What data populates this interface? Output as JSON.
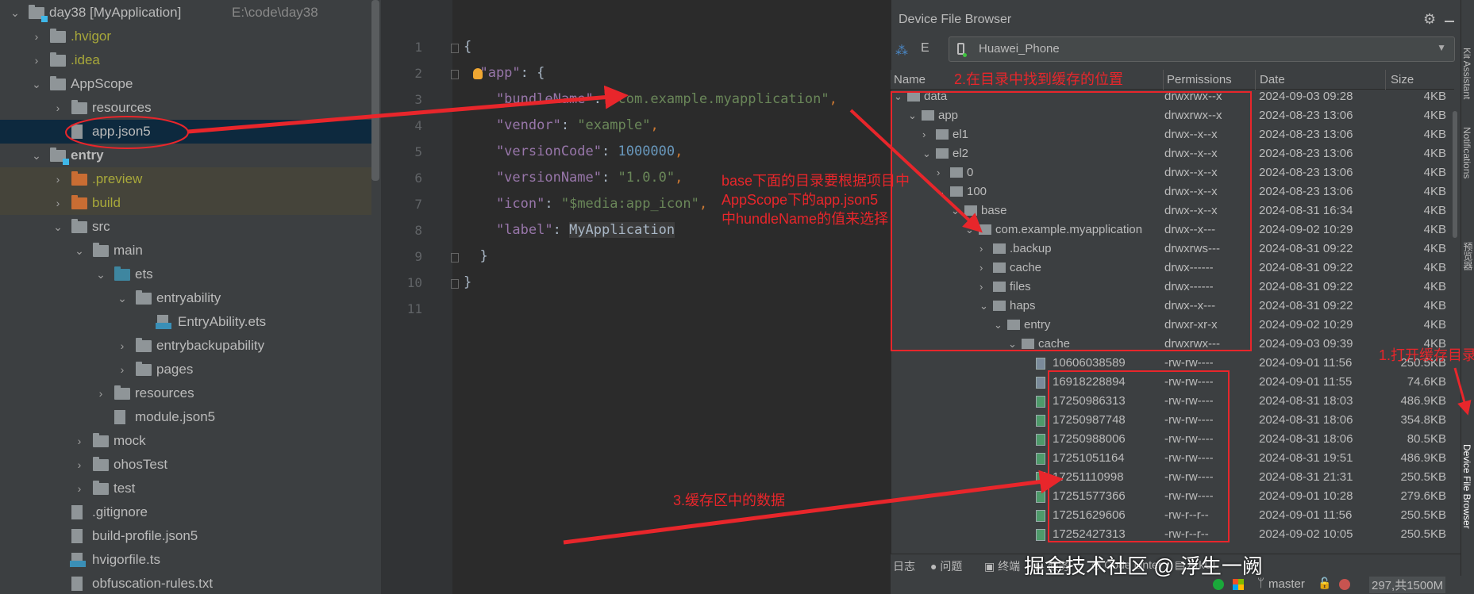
{
  "project_tree": [
    {
      "level": 0,
      "chev": "v",
      "icon": "project",
      "label": "day38 [MyApplication]",
      "path": "E:\\code\\day38"
    },
    {
      "level": 1,
      "chev": ">",
      "icon": "folder",
      "label": ".hvigor",
      "color": "#a8a83a"
    },
    {
      "level": 1,
      "chev": ">",
      "icon": "folder",
      "label": ".idea",
      "color": "#a8a83a"
    },
    {
      "level": 1,
      "chev": "v",
      "icon": "folder",
      "label": "AppScope"
    },
    {
      "level": 2,
      "chev": ">",
      "icon": "folder",
      "label": "resources"
    },
    {
      "level": 2,
      "chev": "",
      "icon": "json",
      "label": "app.json5",
      "selected": true
    },
    {
      "level": 1,
      "chev": "v",
      "icon": "module",
      "label": "entry",
      "bold": true
    },
    {
      "level": 2,
      "chev": ">",
      "icon": "folder-orange",
      "label": ".preview",
      "color": "#a8a83a",
      "excluded": true
    },
    {
      "level": 2,
      "chev": ">",
      "icon": "folder-orange",
      "label": "build",
      "color": "#a8a83a",
      "excluded": true
    },
    {
      "level": 2,
      "chev": "v",
      "icon": "folder",
      "label": "src"
    },
    {
      "level": 3,
      "chev": "v",
      "icon": "folder",
      "label": "main"
    },
    {
      "level": 4,
      "chev": "v",
      "icon": "folder-blue",
      "label": "ets"
    },
    {
      "level": 5,
      "chev": "v",
      "icon": "folder",
      "label": "entryability"
    },
    {
      "level": 6,
      "chev": "",
      "icon": "ets",
      "label": "EntryAbility.ets"
    },
    {
      "level": 5,
      "chev": ">",
      "icon": "folder",
      "label": "entrybackupability"
    },
    {
      "level": 5,
      "chev": ">",
      "icon": "folder",
      "label": "pages"
    },
    {
      "level": 4,
      "chev": ">",
      "icon": "folder",
      "label": "resources"
    },
    {
      "level": 4,
      "chev": "",
      "icon": "json",
      "label": "module.json5"
    },
    {
      "level": 3,
      "chev": ">",
      "icon": "folder",
      "label": "mock"
    },
    {
      "level": 3,
      "chev": ">",
      "icon": "folder",
      "label": "ohosTest"
    },
    {
      "level": 3,
      "chev": ">",
      "icon": "folder",
      "label": "test"
    },
    {
      "level": 2,
      "chev": "",
      "icon": "ignore",
      "label": ".gitignore"
    },
    {
      "level": 2,
      "chev": "",
      "icon": "json",
      "label": "build-profile.json5"
    },
    {
      "level": 2,
      "chev": "",
      "icon": "ts",
      "label": "hvigorfile.ts"
    },
    {
      "level": 2,
      "chev": "",
      "icon": "text",
      "label": "obfuscation-rules.txt"
    }
  ],
  "editor": {
    "line_numbers": [
      "1",
      "2",
      "3",
      "4",
      "5",
      "6",
      "7",
      "8",
      "9",
      "10",
      "11"
    ],
    "lines": [
      [
        {
          "t": "{",
          "c": "b"
        }
      ],
      [
        {
          "t": "  \"app\"",
          "c": "k"
        },
        {
          "t": ": {",
          "c": "b"
        }
      ],
      [
        {
          "t": "    \"bundleName\"",
          "c": "k"
        },
        {
          "t": ": ",
          "c": "b"
        },
        {
          "t": "\"com.example.myapplication\"",
          "c": "s"
        },
        {
          "t": ",",
          "c": "p"
        }
      ],
      [
        {
          "t": "    \"vendor\"",
          "c": "k"
        },
        {
          "t": ": ",
          "c": "b"
        },
        {
          "t": "\"example\"",
          "c": "s"
        },
        {
          "t": ",",
          "c": "p"
        }
      ],
      [
        {
          "t": "    \"versionCode\"",
          "c": "k"
        },
        {
          "t": ": ",
          "c": "b"
        },
        {
          "t": "1000000",
          "c": "n"
        },
        {
          "t": ",",
          "c": "p"
        }
      ],
      [
        {
          "t": "    \"versionName\"",
          "c": "k"
        },
        {
          "t": ": ",
          "c": "b"
        },
        {
          "t": "\"1.0.0\"",
          "c": "s"
        },
        {
          "t": ",",
          "c": "p"
        }
      ],
      [
        {
          "t": "    \"icon\"",
          "c": "k"
        },
        {
          "t": ": ",
          "c": "b"
        },
        {
          "t": "\"$media:app_icon\"",
          "c": "s"
        },
        {
          "t": ",",
          "c": "p"
        }
      ],
      [
        {
          "t": "    \"label\"",
          "c": "k"
        },
        {
          "t": ": ",
          "c": "b"
        },
        {
          "t": "MyApplication",
          "c": "b"
        }
      ],
      [
        {
          "t": "  }",
          "c": "b"
        }
      ],
      [
        {
          "t": "}",
          "c": "b"
        }
      ],
      []
    ]
  },
  "device_file_browser": {
    "title": "Device File Browser",
    "device": "Huawei_Phone",
    "columns": {
      "name": "Name",
      "permissions": "Permissions",
      "date": "Date",
      "size": "Size"
    },
    "rows": [
      {
        "level": 0,
        "chev": "v",
        "type": "dir",
        "name": "data",
        "perm": "drwxrwx--x",
        "date": "2024-09-03 09:28",
        "size": "4KB"
      },
      {
        "level": 1,
        "chev": "v",
        "type": "dir",
        "name": "app",
        "perm": "drwxrwx--x",
        "date": "2024-08-23 13:06",
        "size": "4KB"
      },
      {
        "level": 2,
        "chev": ">",
        "type": "dir",
        "name": "el1",
        "perm": "drwx--x--x",
        "date": "2024-08-23 13:06",
        "size": "4KB"
      },
      {
        "level": 2,
        "chev": "v",
        "type": "dir",
        "name": "el2",
        "perm": "drwx--x--x",
        "date": "2024-08-23 13:06",
        "size": "4KB"
      },
      {
        "level": 3,
        "chev": ">",
        "type": "dir",
        "name": "0",
        "perm": "drwx--x--x",
        "date": "2024-08-23 13:06",
        "size": "4KB"
      },
      {
        "level": 3,
        "chev": "v",
        "type": "dir",
        "name": "100",
        "perm": "drwx--x--x",
        "date": "2024-08-23 13:06",
        "size": "4KB"
      },
      {
        "level": 4,
        "chev": "v",
        "type": "dir",
        "name": "base",
        "perm": "drwx--x--x",
        "date": "2024-08-31 16:34",
        "size": "4KB"
      },
      {
        "level": 5,
        "chev": "v",
        "type": "dir",
        "name": "com.example.myapplication",
        "perm": "drwx--x---",
        "date": "2024-09-02 10:29",
        "size": "4KB"
      },
      {
        "level": 6,
        "chev": ">",
        "type": "dir",
        "name": ".backup",
        "perm": "drwxrws---",
        "date": "2024-08-31 09:22",
        "size": "4KB"
      },
      {
        "level": 6,
        "chev": ">",
        "type": "dir",
        "name": "cache",
        "perm": "drwx------",
        "date": "2024-08-31 09:22",
        "size": "4KB"
      },
      {
        "level": 6,
        "chev": ">",
        "type": "dir",
        "name": "files",
        "perm": "drwx------",
        "date": "2024-08-31 09:22",
        "size": "4KB"
      },
      {
        "level": 6,
        "chev": "v",
        "type": "dir",
        "name": "haps",
        "perm": "drwx--x---",
        "date": "2024-08-31 09:22",
        "size": "4KB"
      },
      {
        "level": 7,
        "chev": "v",
        "type": "dir",
        "name": "entry",
        "perm": "drwxr-xr-x",
        "date": "2024-09-02 10:29",
        "size": "4KB"
      },
      {
        "level": 8,
        "chev": "v",
        "type": "dir",
        "name": "cache",
        "perm": "drwxrwx---",
        "date": "2024-09-03 09:39",
        "size": "4KB"
      },
      {
        "level": 9,
        "chev": "",
        "type": "unknown",
        "name": "10606038589",
        "perm": "-rw-rw----",
        "date": "2024-09-01 11:56",
        "size": "250.5KB"
      },
      {
        "level": 9,
        "chev": "",
        "type": "unknown",
        "name": "16918228894",
        "perm": "-rw-rw----",
        "date": "2024-09-01 11:55",
        "size": "74.6KB"
      },
      {
        "level": 9,
        "chev": "",
        "type": "image",
        "name": "17250986313",
        "perm": "-rw-rw----",
        "date": "2024-08-31 18:03",
        "size": "486.9KB"
      },
      {
        "level": 9,
        "chev": "",
        "type": "image",
        "name": "17250987748",
        "perm": "-rw-rw----",
        "date": "2024-08-31 18:06",
        "size": "354.8KB"
      },
      {
        "level": 9,
        "chev": "",
        "type": "image",
        "name": "17250988006",
        "perm": "-rw-rw----",
        "date": "2024-08-31 18:06",
        "size": "80.5KB"
      },
      {
        "level": 9,
        "chev": "",
        "type": "image",
        "name": "17251051164",
        "perm": "-rw-rw----",
        "date": "2024-08-31 19:51",
        "size": "486.9KB"
      },
      {
        "level": 9,
        "chev": "",
        "type": "image",
        "name": "17251110998",
        "perm": "-rw-rw----",
        "date": "2024-08-31 21:31",
        "size": "250.5KB"
      },
      {
        "level": 9,
        "chev": "",
        "type": "image",
        "name": "17251577366",
        "perm": "-rw-rw----",
        "date": "2024-09-01 10:28",
        "size": "279.6KB"
      },
      {
        "level": 9,
        "chev": "",
        "type": "image",
        "name": "17251629606",
        "perm": "-rw-r--r--",
        "date": "2024-09-01 11:56",
        "size": "250.5KB"
      },
      {
        "level": 9,
        "chev": "",
        "type": "image",
        "name": "17252427313",
        "perm": "-rw-r--r--",
        "date": "2024-09-02 10:05",
        "size": "250.5KB"
      }
    ]
  },
  "right_strip": [
    "Kit Assistant",
    "Notifications",
    "预览器",
    "Device File Browser"
  ],
  "bottom_tabs": [
    "日志",
    "问题",
    "终端",
    "服务",
    "Code Linter",
    "ArkUI"
  ],
  "status_bar": {
    "branch": "master",
    "memory": "297,共1500M"
  },
  "annotations": {
    "step1": "1.打开缓存目录",
    "step2": "2.在目录中找到缓存的位置",
    "step3": "3.缓存区中的数据",
    "note_line1": "base下面的目录要根据项目中",
    "note_line2": "AppScope下的app.json5",
    "note_line3": "中hundleName的值来选择"
  },
  "watermark": "掘金技术社区 @ 浮生一阙",
  "colors": {
    "annotation": "#e8262b",
    "selection": "#0d293e",
    "excluded_row": "#45443a"
  }
}
